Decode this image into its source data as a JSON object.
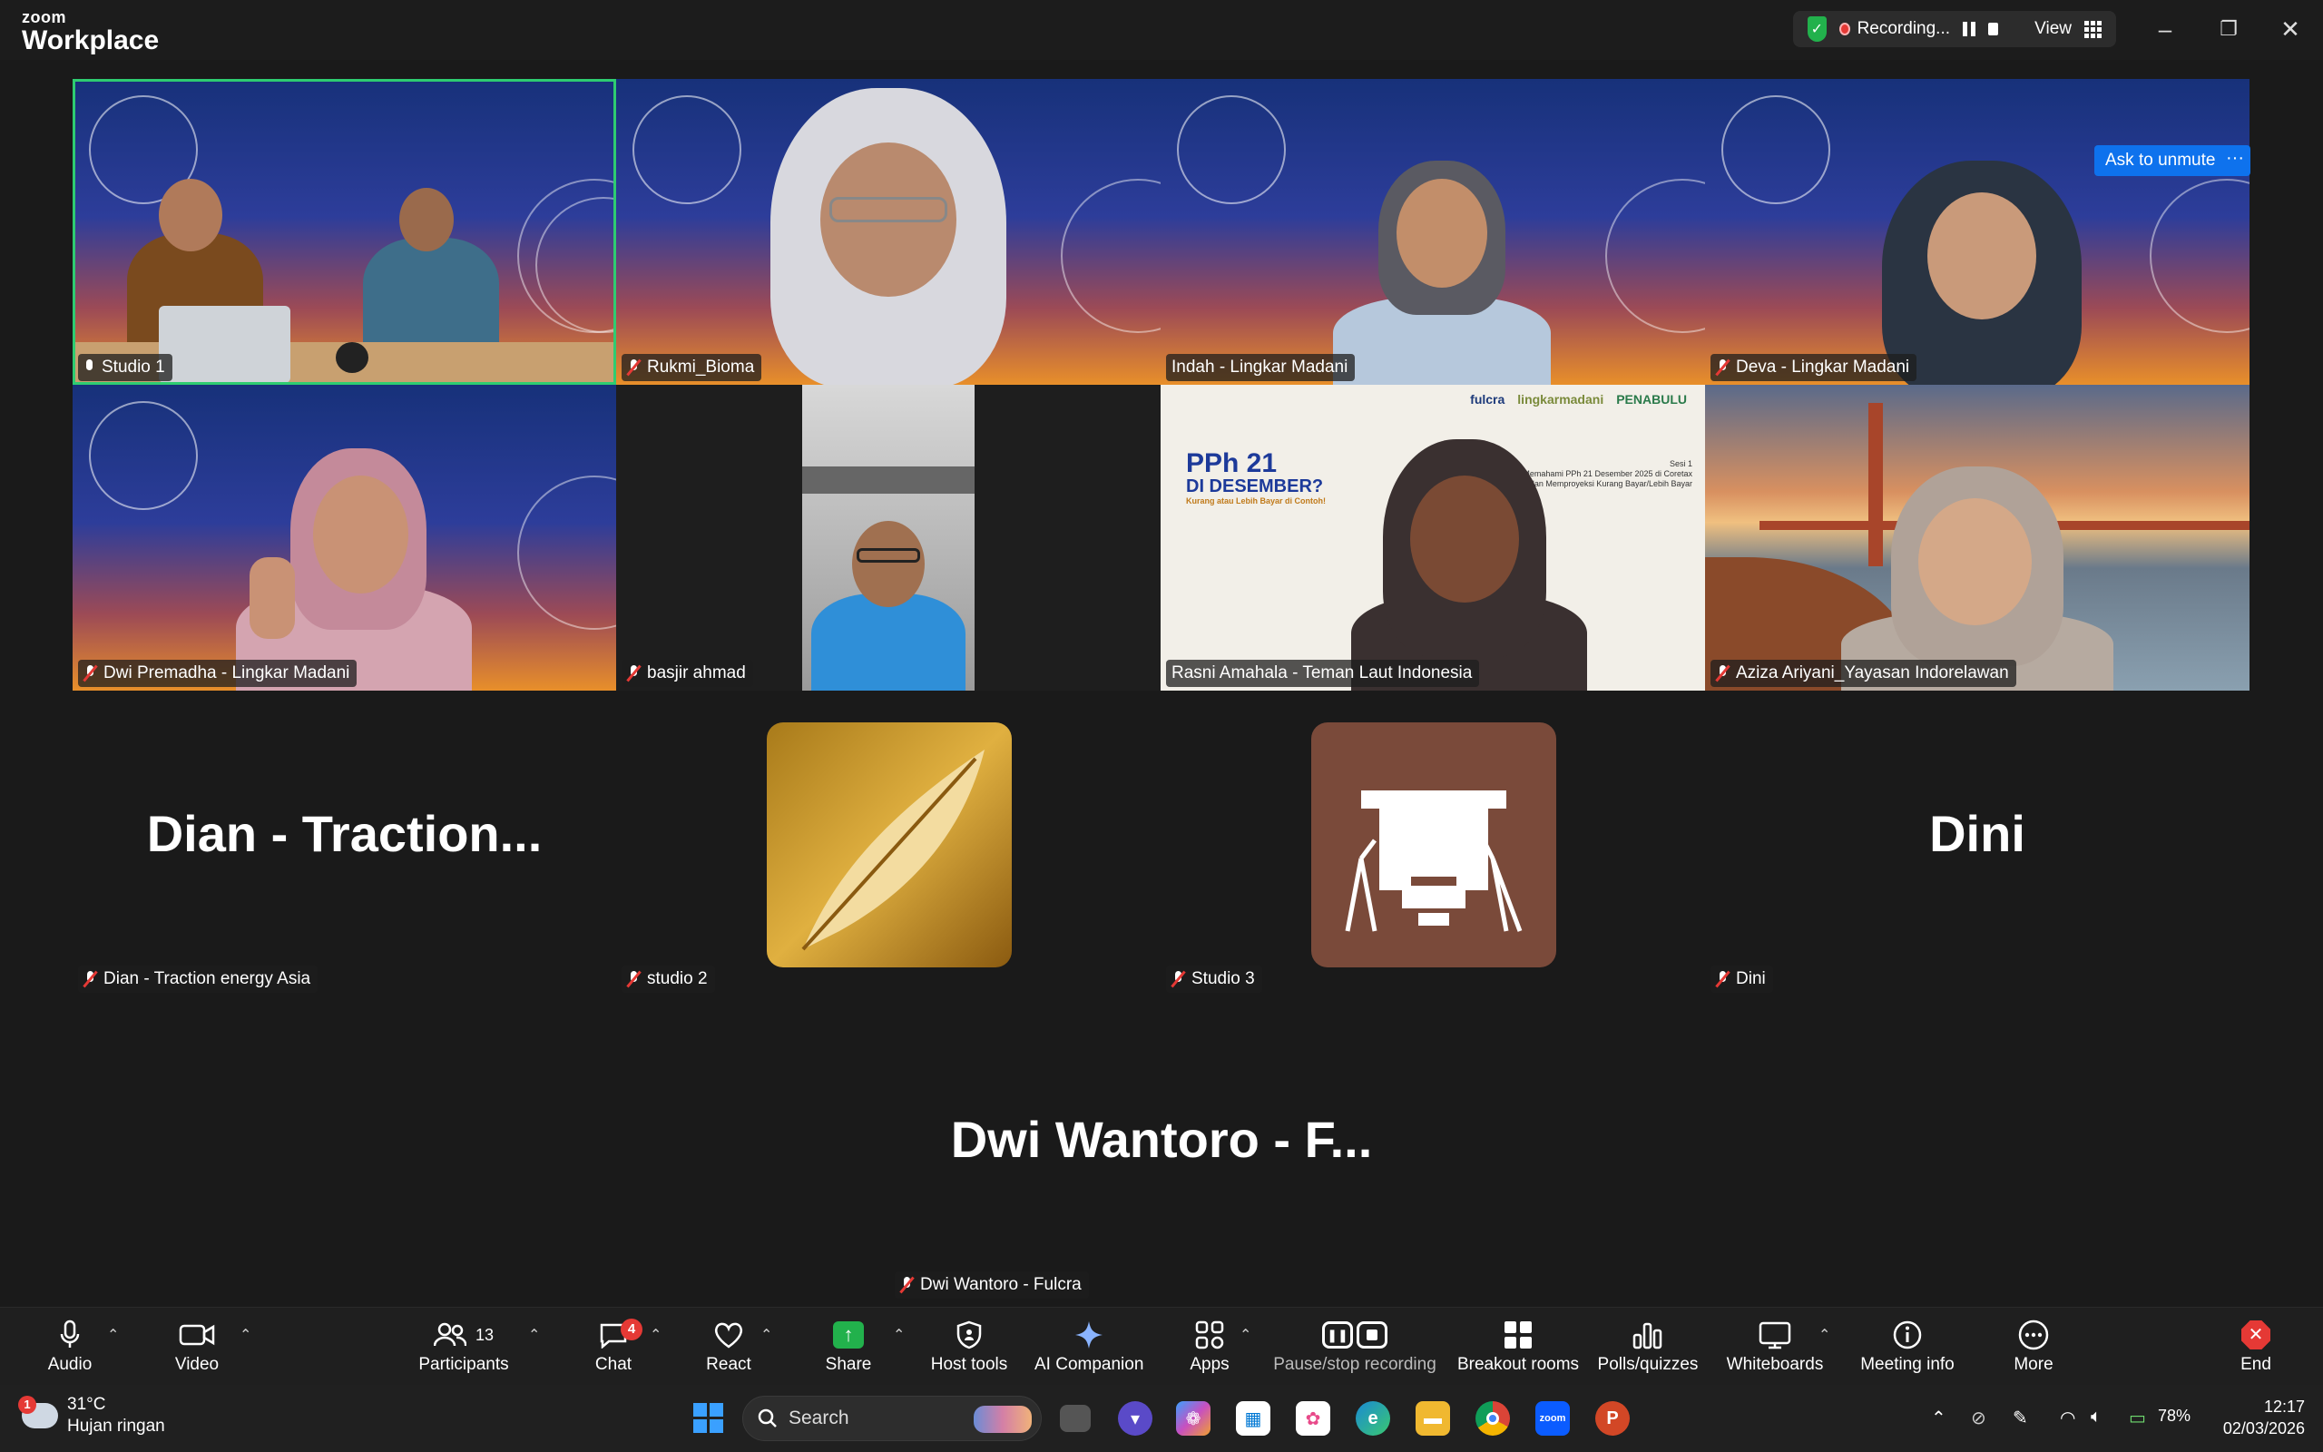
{
  "titlebar": {
    "logo_small": "zoom",
    "logo_big": "Workplace",
    "recording_label": "Recording...",
    "view_label": "View",
    "security_icon": "shield-check-icon",
    "colors": {
      "recording_dot": "#e53935",
      "shield": "#22b14c"
    }
  },
  "ask_unmute": "Ask to unmute",
  "more_mini": "···",
  "participants_grid": [
    {
      "name": "Studio 1",
      "muted": false
    },
    {
      "name": "Rukmi_Bioma",
      "muted": true
    },
    {
      "name": "Indah - Lingkar Madani",
      "muted": false
    },
    {
      "name": "Deva - Lingkar Madani",
      "muted": true
    },
    {
      "name": "Dwi Premadha - Lingkar Madani",
      "muted": true
    },
    {
      "name": "basjir ahmad",
      "muted": true
    },
    {
      "name": "Rasni Amahala - Teman Laut Indonesia",
      "muted": false
    },
    {
      "name": "Aziza Ariyani_Yayasan Indorelawan",
      "muted": true
    },
    {
      "name": "Dian - Traction energy Asia",
      "display": "Dian - Traction...",
      "muted": true
    },
    {
      "name": "studio 2",
      "muted": true
    },
    {
      "name": "Studio 3",
      "muted": true
    },
    {
      "name": "Dini",
      "display": "Dini",
      "muted": true
    },
    {
      "name": "Dwi Wantoro - Fulcra",
      "display": "Dwi Wantoro - F...",
      "muted": true
    }
  ],
  "slide": {
    "title_line1": "PPh 21",
    "title_line2": "DI DESEMBER?",
    "subtitle": "Kurang atau Lebih Bayar di Contoh!",
    "sesi": "Sesi 1",
    "desc": "Memahami PPh 21 Desember 2025 di Coretax dan Memproyeksi Kurang Bayar/Lebih Bayar",
    "brand1": "fulcra",
    "brand2": "lingkarmadani",
    "brand3": "PENABULU"
  },
  "toolbar": {
    "audio": "Audio",
    "video": "Video",
    "participants": "Participants",
    "participants_count": "13",
    "chat": "Chat",
    "chat_badge": "4",
    "react": "React",
    "share": "Share",
    "host_tools": "Host tools",
    "ai_companion": "AI Companion",
    "apps": "Apps",
    "pause_stop": "Pause/stop recording",
    "breakout": "Breakout rooms",
    "polls": "Polls/quizzes",
    "whiteboards": "Whiteboards",
    "meeting_info": "Meeting info",
    "more": "More",
    "end": "End"
  },
  "taskbar": {
    "weather_temp": "31°C",
    "weather_desc": "Hujan ringan",
    "weather_badge": "1",
    "search": "Search",
    "battery": "78%",
    "time": "12:17",
    "date": "02/03/2026"
  }
}
